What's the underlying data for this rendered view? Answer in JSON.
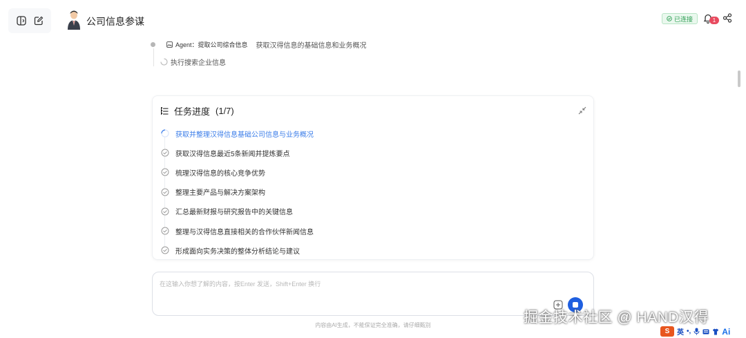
{
  "header": {
    "title": "公司信息参谋",
    "status": "已连接",
    "notification_count": "1"
  },
  "agent": {
    "tag": "Agent：提取公司综合信息",
    "description": "获取汉得信息的基础信息和业务概况",
    "step": "执行搜索企业信息"
  },
  "tasks": {
    "title": "任务进度",
    "progress": "(1/7)",
    "items": [
      {
        "label": "获取并整理汉得信息基础公司信息与业务概况",
        "state": "active"
      },
      {
        "label": "获取汉得信息最近5条新闻并提炼要点",
        "state": "pending"
      },
      {
        "label": "梳理汉得信息的核心竞争优势",
        "state": "pending"
      },
      {
        "label": "整理主要产品与解决方案架构",
        "state": "pending"
      },
      {
        "label": "汇总最新财报与研究报告中的关键信息",
        "state": "pending"
      },
      {
        "label": "整理与汉得信息直接相关的合作伙伴新闻信息",
        "state": "pending"
      },
      {
        "label": "形成面向实务决策的整体分析结论与建议",
        "state": "pending"
      }
    ]
  },
  "input": {
    "placeholder": "在这输入你想了解的内容，按Enter 发送，Shift+Enter 换行"
  },
  "footer": {
    "disclaimer": "内容由AI生成，不能保证完全准确，请仔细甄别"
  },
  "watermark": "掘金技术社区 @ HAND汉得",
  "ime": {
    "logo": "S",
    "lang": "英",
    "ai": "Ai"
  },
  "colors": {
    "accent": "#1f5fe0",
    "active_task": "#3b7de9",
    "status_green": "#2f9e55",
    "badge_red": "#e84a5f"
  }
}
